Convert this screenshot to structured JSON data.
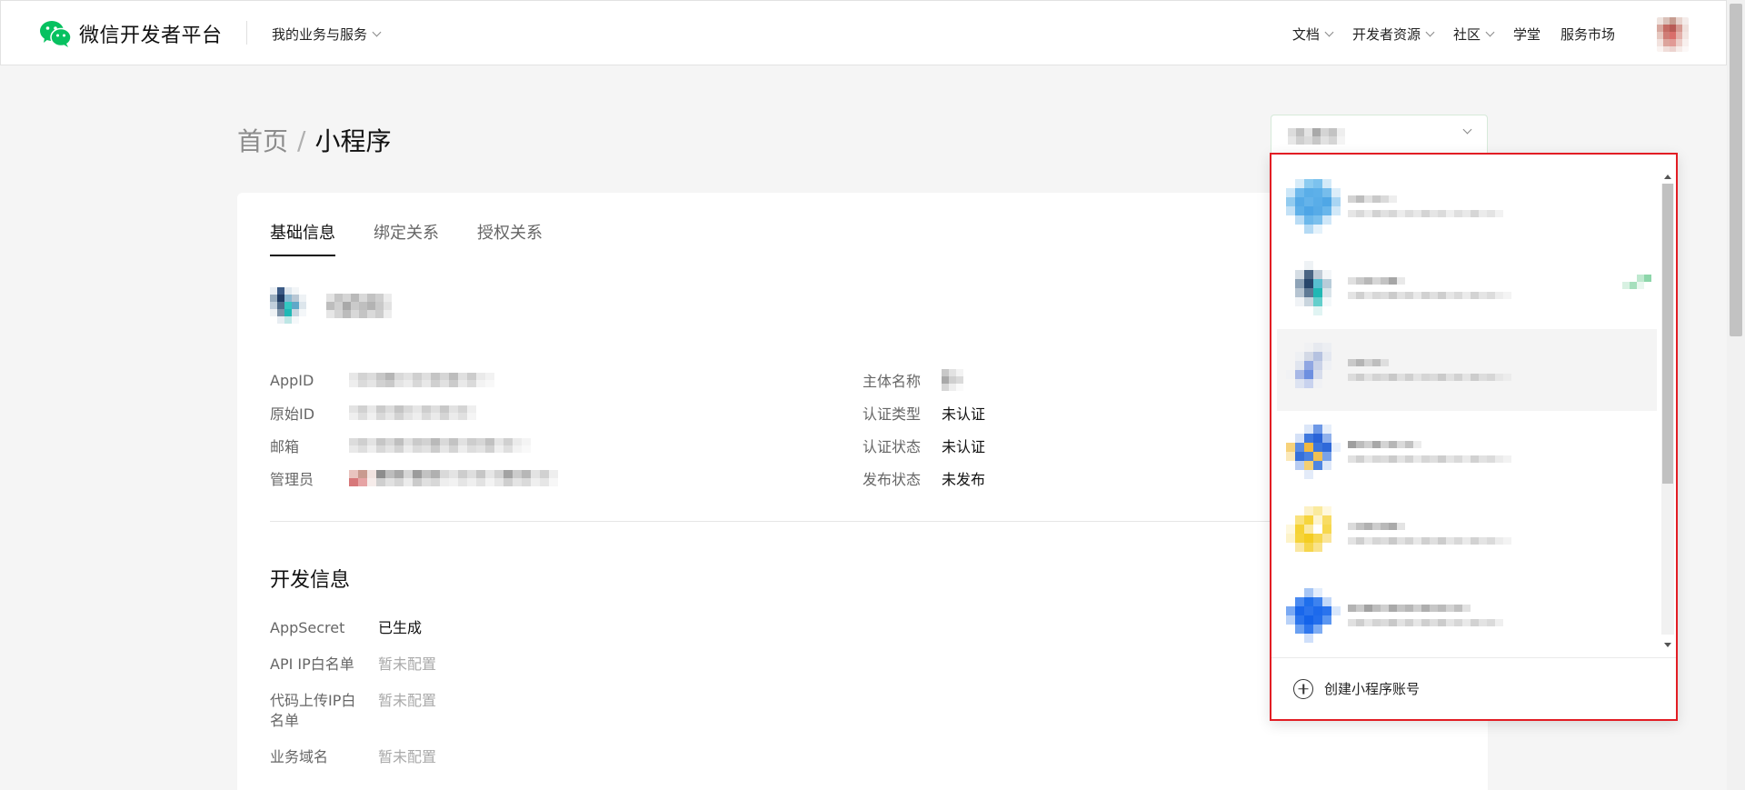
{
  "topbar": {
    "brand_title": "微信开发者平台",
    "biz_menu_label": "我的业务与服务",
    "nav": [
      {
        "label": "文档",
        "has_dropdown": true
      },
      {
        "label": "开发者资源",
        "has_dropdown": true
      },
      {
        "label": "社区",
        "has_dropdown": true
      },
      {
        "label": "学堂",
        "has_dropdown": false
      },
      {
        "label": "服务市场",
        "has_dropdown": false
      }
    ],
    "logo_icon": "wechat-logo-icon",
    "brand_color": "#07c160"
  },
  "breadcrumb": {
    "home": "首页",
    "separator": "/",
    "current": "小程序"
  },
  "tabs": [
    "基础信息",
    "绑定关系",
    "授权关系"
  ],
  "basic_info": {
    "left_labels": [
      "AppID",
      "原始ID",
      "邮箱",
      "管理员"
    ],
    "right": [
      {
        "label": "主体名称",
        "value": ""
      },
      {
        "label": "认证类型",
        "value": "未认证"
      },
      {
        "label": "认证状态",
        "value": "未认证"
      },
      {
        "label": "发布状态",
        "value": "未发布"
      }
    ]
  },
  "dev_info": {
    "title": "开发信息",
    "rows": [
      {
        "label": "AppSecret",
        "value": "已生成",
        "muted": false
      },
      {
        "label": "API IP白名单",
        "value": "暂未配置",
        "muted": true
      },
      {
        "label": "代码上传IP白名单",
        "value": "暂未配置",
        "muted": true
      },
      {
        "label": "业务域名",
        "value": "暂未配置",
        "muted": true
      }
    ]
  },
  "dropdown": {
    "create_label": "创建小程序账号",
    "item_count": 6,
    "hover_index": 2,
    "highlight_border_color": "#e21d24"
  }
}
